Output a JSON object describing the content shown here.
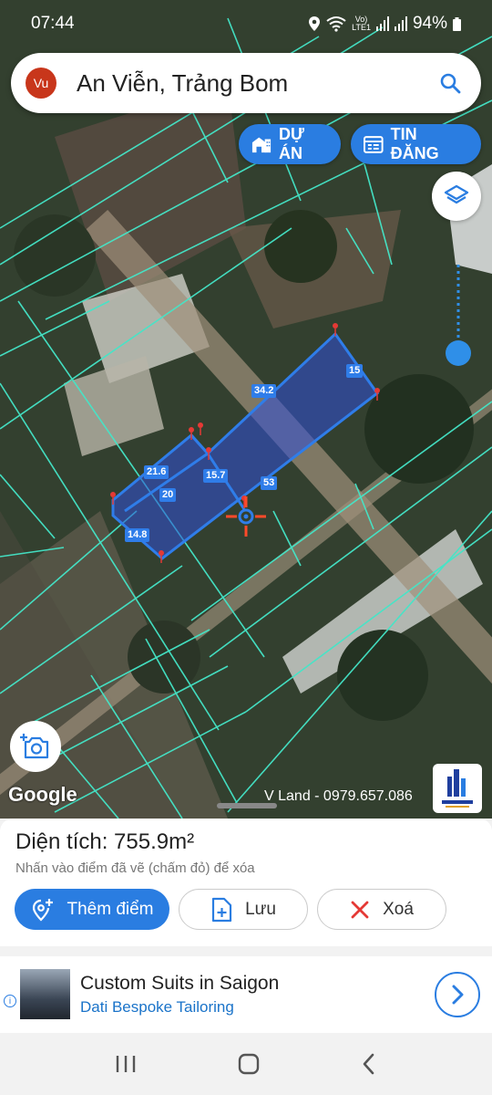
{
  "status": {
    "time": "07:44",
    "network_top": "Vo)",
    "network_bottom": "LTE1",
    "battery": "94%"
  },
  "search": {
    "avatar_initials": "Vu",
    "location": "An Viễn, Trảng Bom"
  },
  "top_buttons": {
    "projects_label": "DỰ ÁN",
    "listings_label": "TIN ĐĂNG"
  },
  "map": {
    "watermark": "V Land - 0979.657.086",
    "google_logo": "Google",
    "segment_labels": [
      "34.2",
      "15",
      "21.6",
      "15.7",
      "20",
      "53",
      "14.8"
    ]
  },
  "sheet": {
    "area_title": "Diện tích: 755.9m²",
    "hint": "Nhấn vào điểm đã vẽ (chấm đỏ) để xóa",
    "add_point_label": "Thêm điểm",
    "save_label": "Lưu",
    "delete_label": "Xoá"
  },
  "ad": {
    "title": "Custom Suits in Saigon",
    "subtitle": "Dati Bespoke Tailoring"
  },
  "colors": {
    "accent": "#2a7de1",
    "parcel_line": "#44e6c8",
    "polygon": "#2f7de9",
    "vertex": "#e53935"
  }
}
